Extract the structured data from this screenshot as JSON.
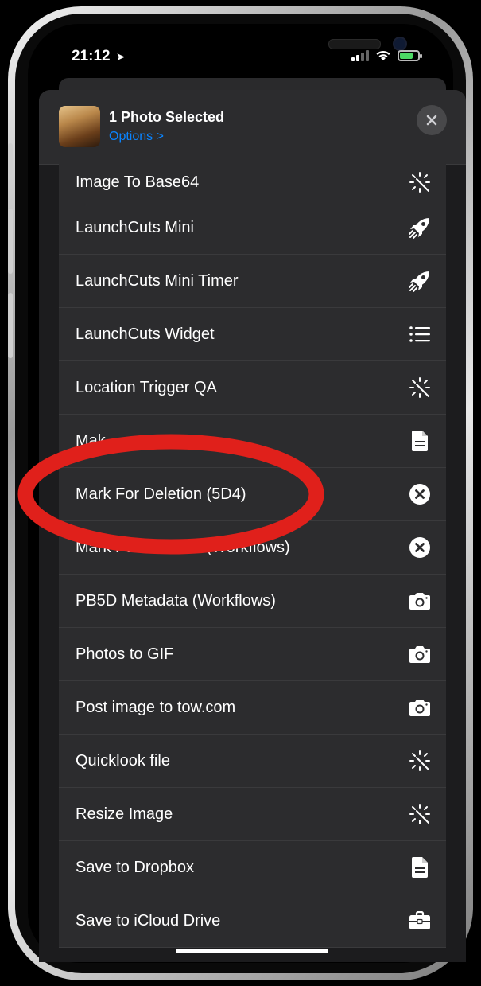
{
  "status_bar": {
    "time": "21:12"
  },
  "sheet": {
    "title": "1 Photo Selected",
    "options_label": "Options >",
    "close_icon": "close-icon"
  },
  "actions": [
    {
      "label": "Image To Base64",
      "icon": "wand-icon"
    },
    {
      "label": "LaunchCuts Mini",
      "icon": "rocket-icon"
    },
    {
      "label": "LaunchCuts Mini Timer",
      "icon": "rocket-icon"
    },
    {
      "label": "LaunchCuts Widget",
      "icon": "list-icon"
    },
    {
      "label": "Location Trigger QA",
      "icon": "wand-icon"
    },
    {
      "label": "Mak",
      "icon": "document-icon"
    },
    {
      "label": "Mark For Deletion (5D4)",
      "icon": "x-circle-icon"
    },
    {
      "label": "Mark For Deletion (Workflows)",
      "icon": "x-circle-icon"
    },
    {
      "label": "PB5D Metadata (Workflows)",
      "icon": "camera-icon"
    },
    {
      "label": "Photos to GIF",
      "icon": "camera-icon"
    },
    {
      "label": "Post image to tow.com",
      "icon": "camera-icon"
    },
    {
      "label": "Quicklook file",
      "icon": "wand-icon"
    },
    {
      "label": "Resize Image",
      "icon": "wand-icon"
    },
    {
      "label": "Save to Dropbox",
      "icon": "document-icon"
    },
    {
      "label": "Save to iCloud Drive",
      "icon": "briefcase-icon"
    }
  ],
  "colors": {
    "annotation": "#e0201b",
    "link": "#0a84ff",
    "battery": "#4cd964"
  }
}
